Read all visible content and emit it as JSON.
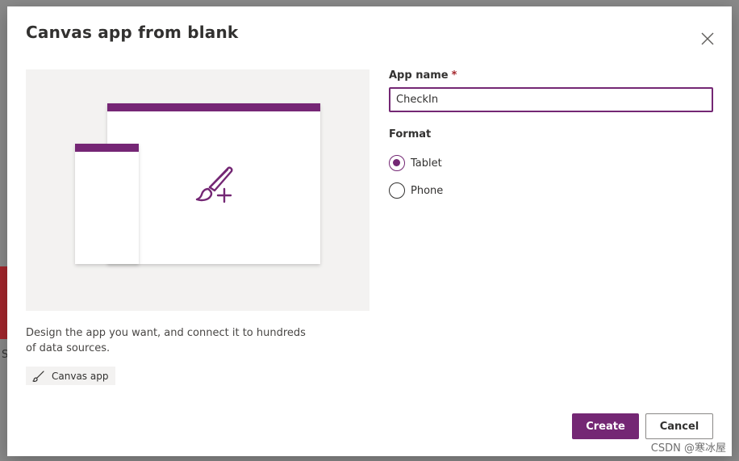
{
  "dialog": {
    "title": "Canvas app from blank",
    "close_icon": "close-icon"
  },
  "preview": {
    "accent_color": "#742774",
    "background_color": "#f3f2f1",
    "icon": "paintbrush-plus-icon"
  },
  "description": "Design the app you want, and connect it to hundreds of data sources.",
  "chip": {
    "icon": "paintbrush-icon",
    "label": "Canvas app"
  },
  "form": {
    "app_name": {
      "label": "App name",
      "required_mark": "*",
      "value": "CheckIn"
    },
    "format": {
      "label": "Format",
      "options": [
        {
          "label": "Tablet",
          "selected": true
        },
        {
          "label": "Phone",
          "selected": false
        }
      ]
    }
  },
  "buttons": {
    "create": "Create",
    "cancel": "Cancel"
  },
  "watermark": "CSDN @寒冰屋",
  "colors": {
    "primary": "#742774",
    "required": "#a4262c",
    "text": "#323130"
  }
}
